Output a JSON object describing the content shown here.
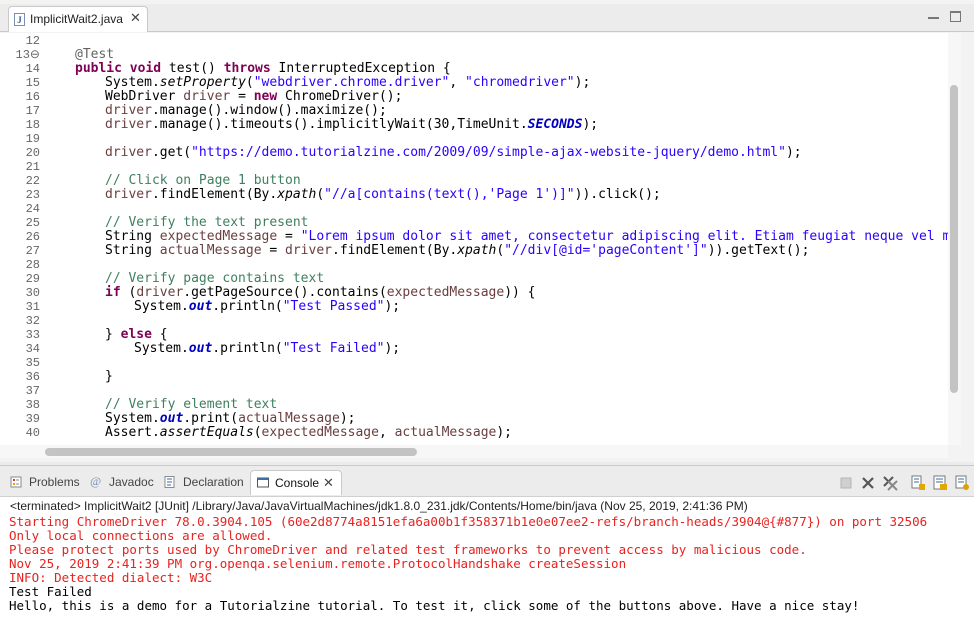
{
  "editor": {
    "tab_label": "ImplicitWait2.java",
    "file_icon_letter": "J",
    "line_numbers": [
      "12",
      "13⊖",
      "14",
      "15",
      "16",
      "17",
      "18",
      "19",
      "20",
      "21",
      "22",
      "23",
      "24",
      "25",
      "26",
      "27",
      "28",
      "29",
      "30",
      "31",
      "32",
      "33",
      "34",
      "35",
      "36",
      "37",
      "38",
      "39",
      "40"
    ],
    "code": {
      "l13_annotation": "@Test",
      "l14": {
        "kw1": "public void",
        "t1": " test() ",
        "kw2": "throws",
        "t2": " InterruptedException {"
      },
      "l15": {
        "t1": "System.",
        "m1": "setProperty",
        "t2": "(",
        "s1": "\"webdriver.chrome.driver\"",
        "t3": ", ",
        "s2": "\"chromedriver\"",
        "t4": ");"
      },
      "l16": {
        "t1": "WebDriver ",
        "v1": "driver",
        "t2": " = ",
        "kw1": "new",
        "t3": " ChromeDriver();"
      },
      "l17": {
        "v1": "driver",
        "t1": ".manage().window().maximize();"
      },
      "l18": {
        "v1": "driver",
        "t1": ".manage().timeouts().implicitlyWait(30,TimeUnit.",
        "f1": "SECONDS",
        "t2": ");"
      },
      "l20": {
        "v1": "driver",
        "t1": ".get(",
        "s1": "\"https://demo.tutorialzine.com/2009/09/simple-ajax-website-jquery/demo.html\"",
        "t2": ");"
      },
      "l22_comment": "// Click on Page 1 button",
      "l23": {
        "v1": "driver",
        "t1": ".findElement(By.",
        "m1": "xpath",
        "t2": "(",
        "s1": "\"//a[contains(text(),'Page 1')]\"",
        "t3": ")).click();"
      },
      "l25_comment": "// Verify the text present",
      "l26": {
        "t1": "String ",
        "v1": "expectedMessage",
        "t2": " = ",
        "s1": "\"Lorem ipsum dolor sit amet, consectetur adipiscing elit. Etiam feugiat neque vel metus sod"
      },
      "l27": {
        "t1": "String ",
        "v1": "actualMessage",
        "t2": " = ",
        "v2": "driver",
        "t3": ".findElement(By.",
        "m1": "xpath",
        "t4": "(",
        "s1": "\"//div[@id='pageContent']\"",
        "t5": ")).getText();"
      },
      "l29_comment": "// Verify page contains text",
      "l30": {
        "kw1": "if",
        "t1": " (",
        "v1": "driver",
        "t2": ".getPageSource().contains(",
        "v2": "expectedMessage",
        "t3": ")) {"
      },
      "l31": {
        "t1": "System.",
        "f1": "out",
        "t2": ".println(",
        "s1": "\"Test Passed\"",
        "t3": ");"
      },
      "l33": {
        "t1": "} ",
        "kw1": "else",
        "t2": " {"
      },
      "l34": {
        "t1": "System.",
        "f1": "out",
        "t2": ".println(",
        "s1": "\"Test Failed\"",
        "t3": ");"
      },
      "l36": "}",
      "l38_comment": "// Verify element text",
      "l39": {
        "t1": "System.",
        "f1": "out",
        "t2": ".print(",
        "v1": "actualMessage",
        "t3": ");"
      },
      "l40": {
        "t1": "Assert.",
        "m1": "assertEquals",
        "t2": "(",
        "v1": "expectedMessage",
        "t3": ", ",
        "v2": "actualMessage",
        "t4": ");"
      }
    }
  },
  "views": {
    "tabs": [
      {
        "label": "Problems",
        "icon": "problems-icon"
      },
      {
        "label": "Javadoc",
        "icon": "javadoc-icon"
      },
      {
        "label": "Declaration",
        "icon": "declaration-icon"
      },
      {
        "label": "Console",
        "icon": "console-icon"
      }
    ],
    "active_tab": "Console",
    "toolbar_icons": [
      "terminate-icon",
      "remove-launch-icon",
      "remove-all-terminated-icon",
      "clear-console-icon",
      "scroll-lock-icon",
      "pin-console-icon"
    ]
  },
  "console": {
    "terminated": "<terminated> ImplicitWait2 [JUnit] /Library/Java/JavaVirtualMachines/jdk1.8.0_231.jdk/Contents/Home/bin/java (Nov 25, 2019, 2:41:36 PM)",
    "lines": [
      {
        "text": "Starting ChromeDriver 78.0.3904.105 (60e2d8774a8151efa6a00b1f358371b1e0e07ee2-refs/branch-heads/3904@{#877}) on port 32506",
        "stream": "stderr"
      },
      {
        "text": "Only local connections are allowed.",
        "stream": "stderr"
      },
      {
        "text": "Please protect ports used by ChromeDriver and related test frameworks to prevent access by malicious code.",
        "stream": "stderr"
      },
      {
        "text": "Nov 25, 2019 2:41:39 PM org.openqa.selenium.remote.ProtocolHandshake createSession",
        "stream": "stderr"
      },
      {
        "text": "INFO: Detected dialect: W3C",
        "stream": "stderr"
      },
      {
        "text": "Test Failed",
        "stream": "stdout"
      },
      {
        "text": "Hello, this is a demo for a Tutorialzine tutorial. To test it, click some of the buttons above. Have a nice stay!",
        "stream": "stdout"
      }
    ]
  },
  "colors": {
    "keyword": "#7f0055",
    "string": "#2a00ff",
    "comment": "#3f7f5f",
    "local_variable": "#6a3e3e",
    "static_field": "#0000c0",
    "stderr": "#e8221f",
    "stdout": "#000000"
  }
}
